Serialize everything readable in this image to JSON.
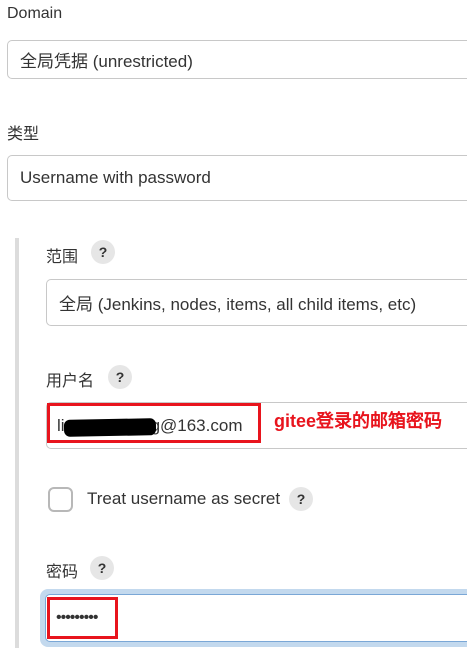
{
  "domain_section": {
    "label": "Domain",
    "value": "全局凭据 (unrestricted)"
  },
  "kind_section": {
    "label": "类型",
    "value": "Username with password"
  },
  "scope_section": {
    "label": "范围",
    "help": "?",
    "value": "全局 (Jenkins, nodes, items, all child items, etc)"
  },
  "username_section": {
    "label": "用户名",
    "help": "?",
    "value_prefix": "li",
    "value_suffix": "g@163.com",
    "annotation": "gitee登录的邮箱密码"
  },
  "secret_option": {
    "label": "Treat username as secret",
    "help": "?",
    "checked": false
  },
  "password_section": {
    "label": "密码",
    "help": "?",
    "value": "•••••••••"
  },
  "colors": {
    "annotation_red": "#e8141d",
    "focus_blue": "#c3d9ee"
  }
}
